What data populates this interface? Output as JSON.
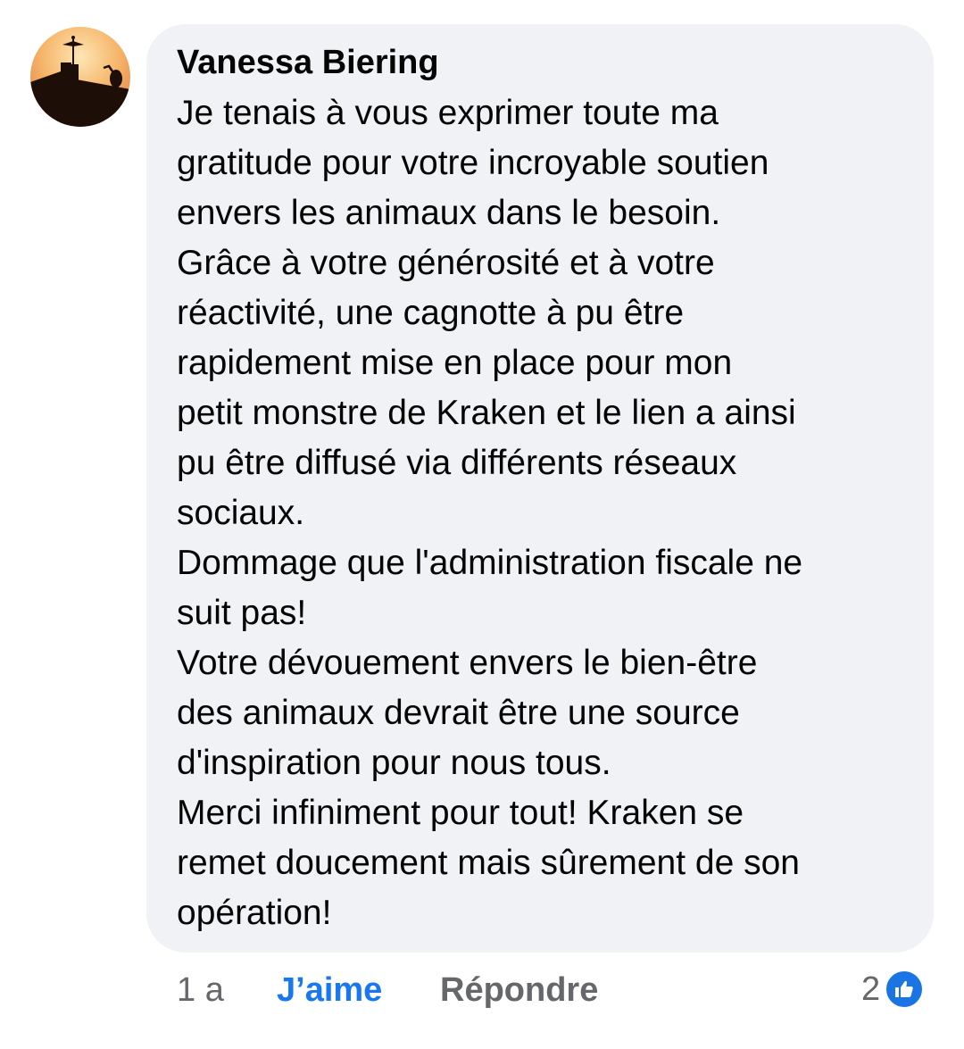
{
  "comment": {
    "author": "Vanessa Biering",
    "lines": [
      "Je tenais à vous exprimer toute ma",
      "gratitude pour votre incroyable soutien",
      "envers les animaux dans le besoin.",
      "Grâce à votre générosité et à votre",
      "réactivité, une cagnotte à pu être",
      "rapidement mise en place pour mon",
      "petit monstre de Kraken et le lien a ainsi",
      "pu être diffusé via différents réseaux",
      "sociaux.",
      "Dommage que l'administration fiscale ne",
      "suit pas!",
      "Votre dévouement envers le bien-être",
      "des animaux devrait être une source",
      "d'inspiration pour nous tous.",
      "Merci infiniment pour tout! Kraken se",
      "remet doucement mais sûrement de son",
      "opération!"
    ]
  },
  "actions": {
    "time": "1 a",
    "like_label": "J’aime",
    "reply_label": "Répondre",
    "reaction_count": "2",
    "reaction_icon": "thumbs-up-icon"
  },
  "colors": {
    "bubble": "#f0f2f5",
    "like_active": "#1877f2",
    "muted": "#65676b",
    "badge": "#1b74e4"
  }
}
